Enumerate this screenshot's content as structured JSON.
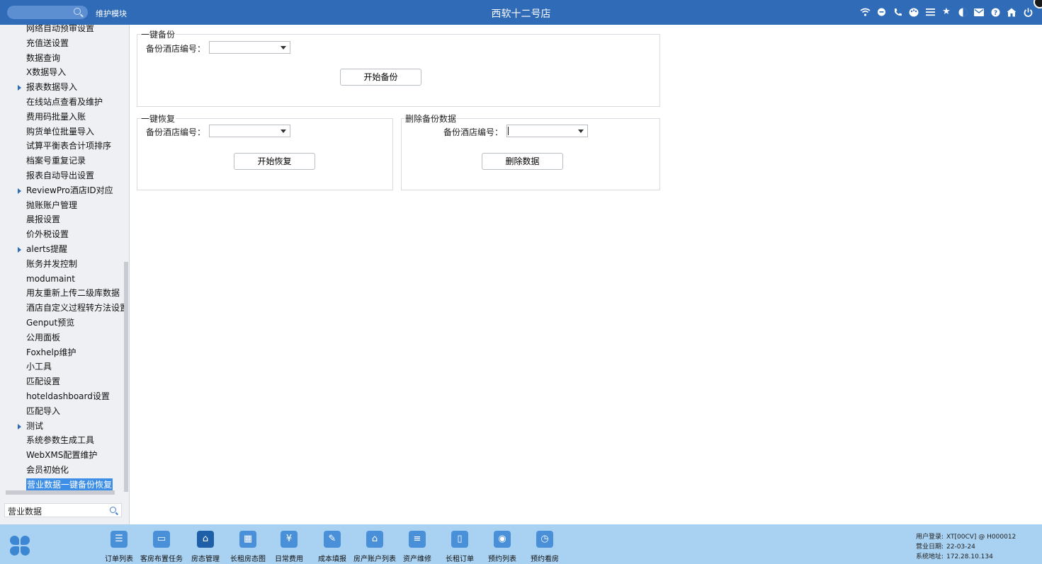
{
  "header": {
    "module_label": "维护模块",
    "title": "西软十二号店",
    "icons": [
      "wifi-icon",
      "chat-icon",
      "phone-icon",
      "palette-icon",
      "menu-icon",
      "star-icon",
      "theme-icon",
      "mail-icon",
      "help-icon",
      "home-icon",
      "power-icon"
    ]
  },
  "sidebar": {
    "items": [
      {
        "label": "网络自动预审设置",
        "expandable": false
      },
      {
        "label": "充值送设置",
        "expandable": false
      },
      {
        "label": "数据查询",
        "expandable": false
      },
      {
        "label": "X数据导入",
        "expandable": false
      },
      {
        "label": "报表数据导入",
        "expandable": true
      },
      {
        "label": "在线站点查看及维护",
        "expandable": false
      },
      {
        "label": "费用码批量入账",
        "expandable": false
      },
      {
        "label": "购货单位批量导入",
        "expandable": false
      },
      {
        "label": "试算平衡表合计项排序",
        "expandable": false
      },
      {
        "label": "档案号重复记录",
        "expandable": false
      },
      {
        "label": "报表自动导出设置",
        "expandable": false
      },
      {
        "label": "ReviewPro酒店ID对应",
        "expandable": true
      },
      {
        "label": "抛账账户管理",
        "expandable": false
      },
      {
        "label": "晨报设置",
        "expandable": false
      },
      {
        "label": "价外税设置",
        "expandable": false
      },
      {
        "label": "alerts提醒",
        "expandable": true
      },
      {
        "label": "账务并发控制",
        "expandable": false
      },
      {
        "label": "modumaint",
        "expandable": false
      },
      {
        "label": "用友重新上传二级库数据",
        "expandable": false
      },
      {
        "label": "酒店自定义过程转方法设置",
        "expandable": false
      },
      {
        "label": "Genput预览",
        "expandable": false
      },
      {
        "label": "公用面板",
        "expandable": false
      },
      {
        "label": "Foxhelp维护",
        "expandable": false
      },
      {
        "label": "小工具",
        "expandable": false
      },
      {
        "label": "匹配设置",
        "expandable": false
      },
      {
        "label": "hoteldashboard设置",
        "expandable": false
      },
      {
        "label": "匹配导入",
        "expandable": false
      },
      {
        "label": "测试",
        "expandable": true
      },
      {
        "label": "系统参数生成工具",
        "expandable": false
      },
      {
        "label": "WebXMS配置维护",
        "expandable": false
      },
      {
        "label": "会员初始化",
        "expandable": false
      },
      {
        "label": "营业数据一键备份恢复",
        "expandable": false,
        "selected": true
      }
    ],
    "search_value": "营业数据"
  },
  "backup": {
    "legend": "一键备份",
    "field_label": "备份酒店编号：",
    "select_value": "",
    "button": "开始备份"
  },
  "restore": {
    "legend": "一键恢复",
    "field_label": "备份酒店编号：",
    "select_value": "",
    "button": "开始恢复"
  },
  "delete": {
    "legend": "删除备份数据",
    "field_label": "备份酒店编号：",
    "select_value": "",
    "button": "删除数据"
  },
  "bottom": {
    "tools": [
      {
        "label": "订单列表",
        "icon": "list-icon",
        "glyph": "☰"
      },
      {
        "label": "客房布置任务",
        "icon": "bed-icon",
        "glyph": "▭"
      },
      {
        "label": "房态管理",
        "icon": "house-icon",
        "glyph": "⌂"
      },
      {
        "label": "长租房态图",
        "icon": "building-icon",
        "glyph": "▦"
      },
      {
        "label": "日常费用",
        "icon": "yen-icon",
        "glyph": "¥"
      },
      {
        "label": "成本填报",
        "icon": "edit-icon",
        "glyph": "✎"
      },
      {
        "label": "房产账户列表",
        "icon": "property-icon",
        "glyph": "⌂"
      },
      {
        "label": "资产维修",
        "icon": "database-icon",
        "glyph": "≡"
      },
      {
        "label": "长租订单",
        "icon": "book-icon",
        "glyph": "▯"
      },
      {
        "label": "预约列表",
        "icon": "calendar-icon",
        "glyph": "◉"
      },
      {
        "label": "预约看房",
        "icon": "clock-icon",
        "glyph": "◷"
      }
    ],
    "info": {
      "user_label": "用户登录:",
      "user_value": "XT[00CV] @ H000012",
      "date_label": "营业日期:",
      "date_value": "22-03-24",
      "addr_label": "系统地址:",
      "addr_value": "172.28.10.134"
    }
  }
}
